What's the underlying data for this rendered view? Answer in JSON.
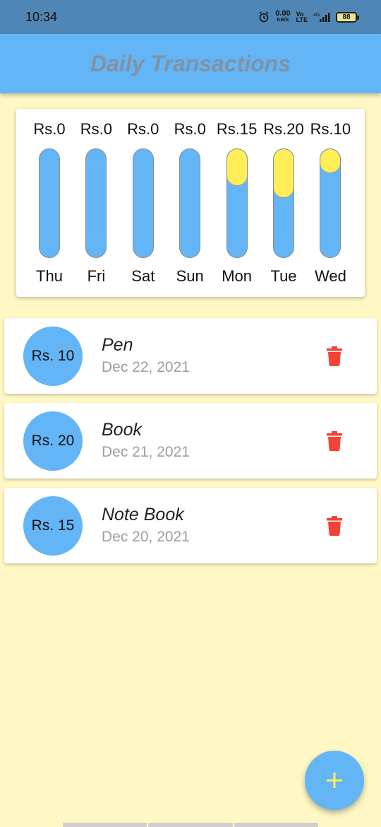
{
  "status_bar": {
    "time": "10:34",
    "net_speed_value": "0.00",
    "net_speed_unit": "KB/S",
    "volte_top": "Vo",
    "volte_bottom": "LTE",
    "network_type": "4G",
    "battery": "88",
    "icons": [
      "alarm-icon",
      "signal-icon",
      "battery-icon"
    ]
  },
  "app_bar": {
    "title": "Daily Transactions"
  },
  "chart": {
    "bars": [
      {
        "day": "Thu",
        "amount_label": "Rs.0",
        "fill_fraction": 0.0
      },
      {
        "day": "Fri",
        "amount_label": "Rs.0",
        "fill_fraction": 0.0
      },
      {
        "day": "Sat",
        "amount_label": "Rs.0",
        "fill_fraction": 0.0
      },
      {
        "day": "Sun",
        "amount_label": "Rs.0",
        "fill_fraction": 0.0
      },
      {
        "day": "Mon",
        "amount_label": "Rs.15",
        "fill_fraction": 0.333
      },
      {
        "day": "Tue",
        "amount_label": "Rs.20",
        "fill_fraction": 0.444
      },
      {
        "day": "Wed",
        "amount_label": "Rs.10",
        "fill_fraction": 0.222
      }
    ]
  },
  "transactions": [
    {
      "amount": "Rs. 10",
      "title": "Pen",
      "date": "Dec 22, 2021"
    },
    {
      "amount": "Rs. 20",
      "title": "Book",
      "date": "Dec 21, 2021"
    },
    {
      "amount": "Rs. 15",
      "title": "Note Book",
      "date": "Dec 20, 2021"
    }
  ],
  "fab": {
    "icon": "plus-icon"
  },
  "colors": {
    "background": "#fff8c4",
    "primary": "#64b5f6",
    "accent": "#ffee58",
    "delete": "#f44336",
    "title_text": "#7f93a4"
  }
}
